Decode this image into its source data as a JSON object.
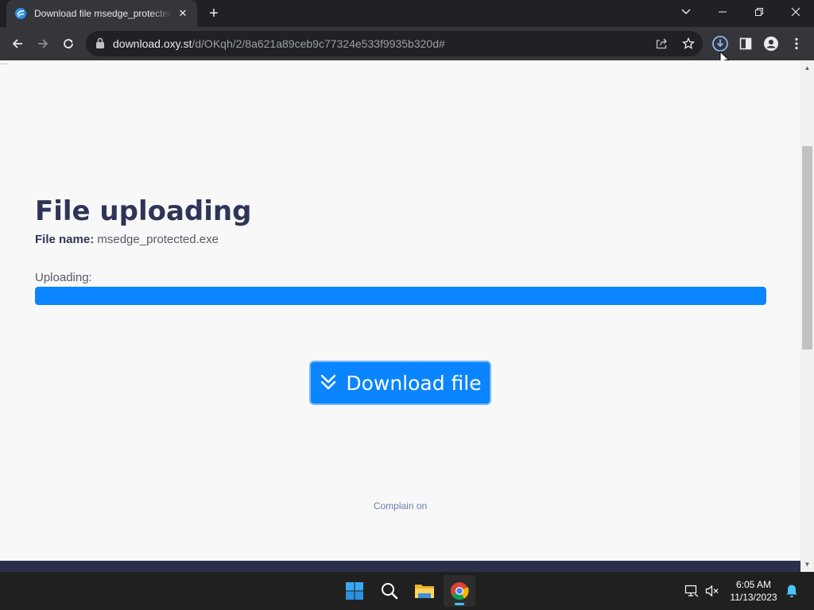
{
  "browser": {
    "tab": {
      "title": "Download file msedge_protected.exe",
      "close_glyph": "✕"
    },
    "new_tab_glyph": "+",
    "address": {
      "host": "download.oxy.st",
      "path": "/d/OKqh/2/8a621a89ceb9c77324e533f9935b320d#"
    },
    "icons": [
      "back-icon",
      "forward-icon",
      "reload-icon",
      "lock-icon",
      "share-icon",
      "bookmark-star-icon",
      "downloads-icon",
      "side-panel-icon",
      "profile-icon",
      "menu-icon",
      "tab-search-icon",
      "minimize-icon",
      "restore-icon",
      "close-window-icon"
    ]
  },
  "page": {
    "title": "File uploading",
    "file_label": "File name:",
    "file_name": "msedge_protected.exe",
    "uploading_label": "Uploading:",
    "upload_progress": 1.0,
    "download_button": "Download file",
    "complain_text": "Complain on"
  },
  "colors": {
    "accent": "#0b84ff",
    "title": "#2e3556",
    "footer": "#2b2f4a"
  },
  "taskbar": {
    "apps": [
      "start-icon",
      "search-icon",
      "file-explorer-icon",
      "chrome-icon"
    ],
    "tray": [
      "network-icon",
      "volume-muted-icon",
      "notification-bell-icon"
    ],
    "time": "6:05 AM",
    "date": "11/13/2023"
  }
}
